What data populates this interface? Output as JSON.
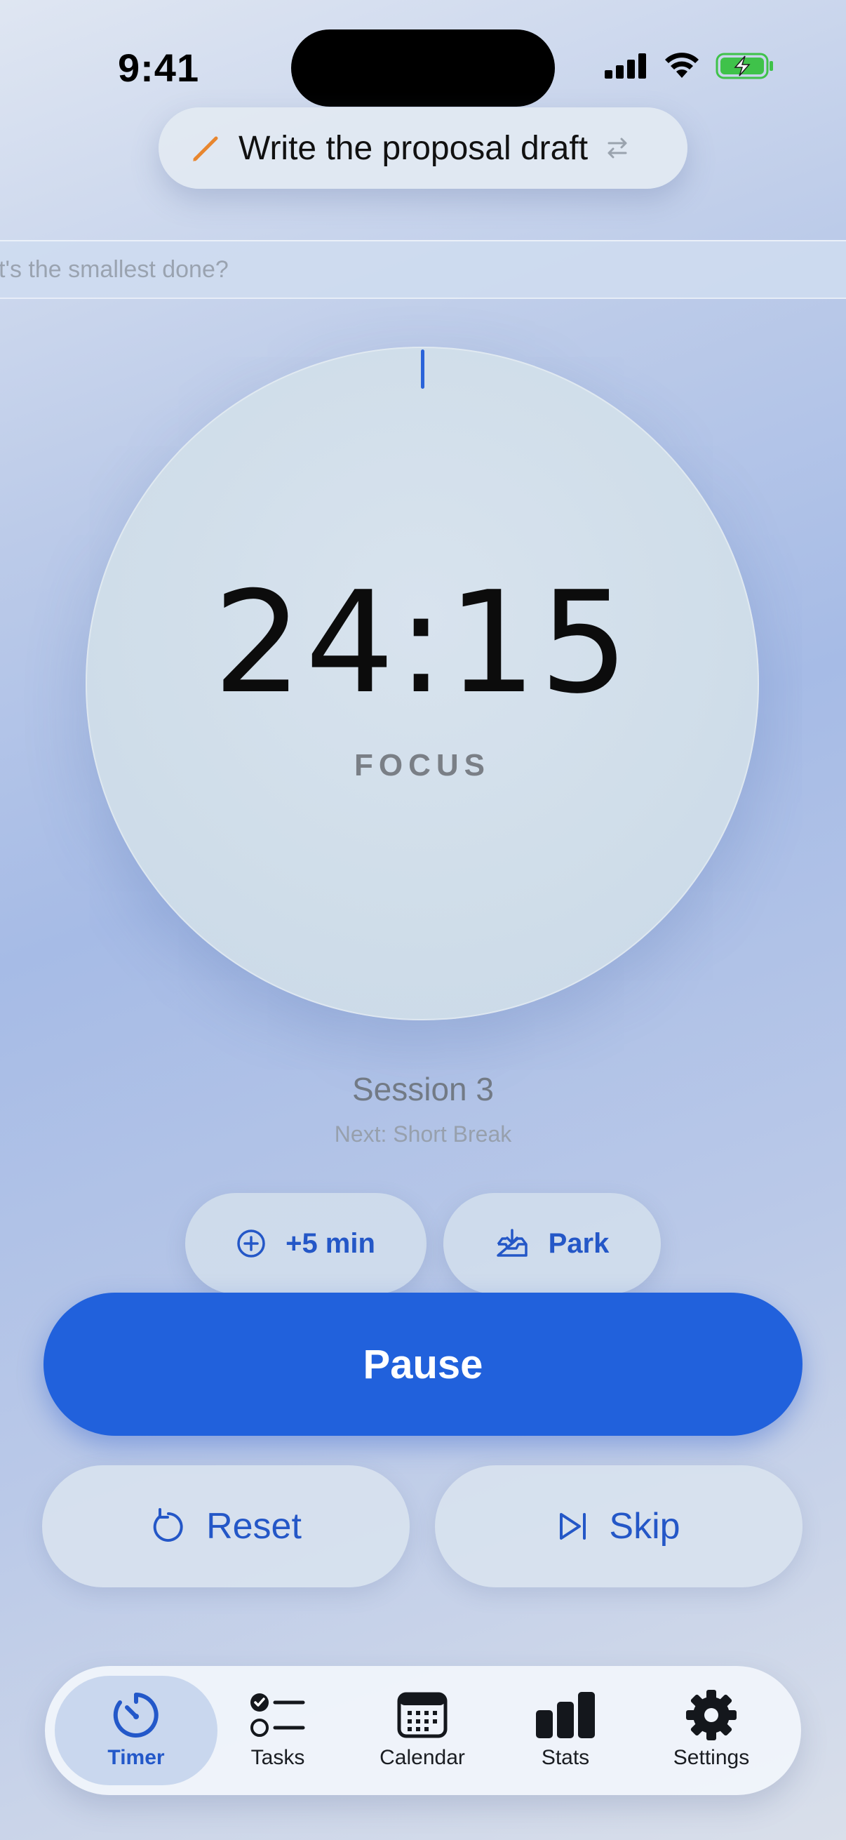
{
  "status_bar": {
    "time": "9:41"
  },
  "current_task": {
    "title": "Write the proposal draft"
  },
  "note_input": {
    "placeholder": "t's the smallest done?"
  },
  "timer": {
    "time": "24:15",
    "mode": "FOCUS",
    "progress": 0.0
  },
  "session": {
    "label": "Session 3",
    "next": "Next: Short Break"
  },
  "actions": {
    "add_time_label": "+5 min",
    "park_label": "Park",
    "pause_label": "Pause",
    "reset_label": "Reset",
    "skip_label": "Skip"
  },
  "tabs": [
    {
      "label": "Timer",
      "icon": "timer-icon",
      "active": true
    },
    {
      "label": "Tasks",
      "icon": "tasks-icon",
      "active": false
    },
    {
      "label": "Calendar",
      "icon": "calendar-icon",
      "active": false
    },
    {
      "label": "Stats",
      "icon": "stats-icon",
      "active": false
    },
    {
      "label": "Settings",
      "icon": "gear-icon",
      "active": false
    }
  ],
  "colors": {
    "accent": "#2161dc",
    "accent_text": "#2457c7",
    "pencil": "#e8862f",
    "battery": "#3fc24a"
  }
}
